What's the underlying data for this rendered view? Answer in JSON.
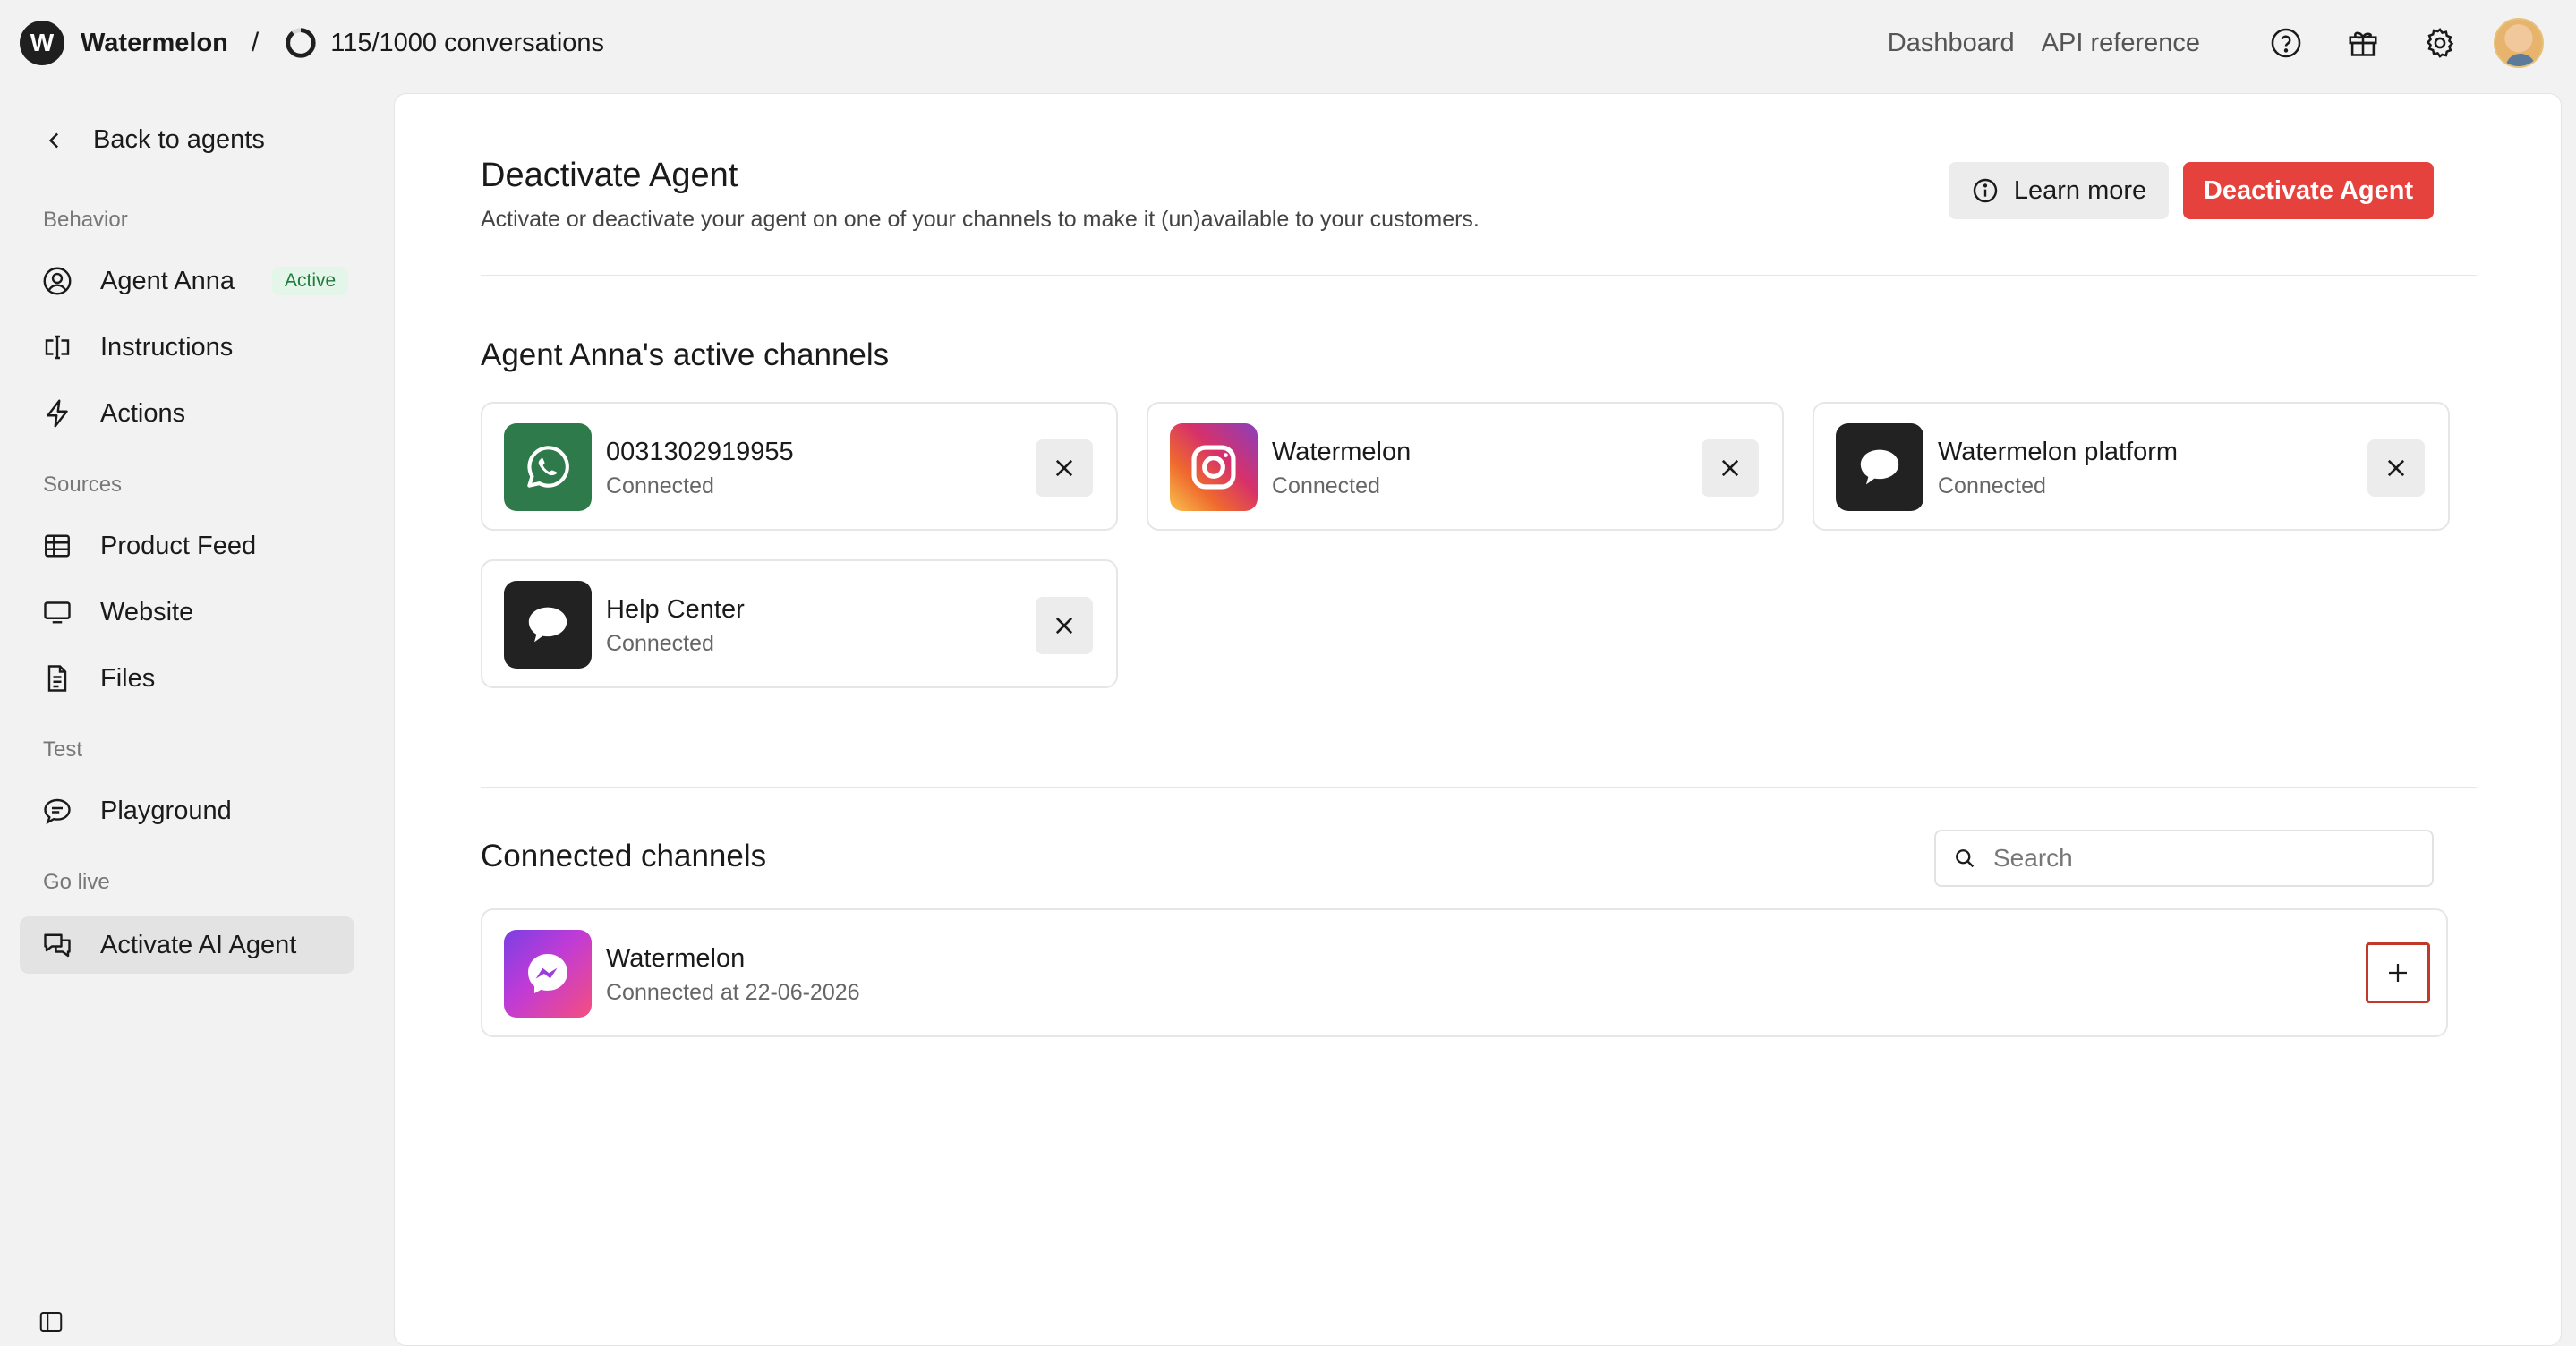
{
  "header": {
    "logo_letter": "W",
    "workspace": "Watermelon",
    "separator": "/",
    "usage": "115/1000 conversations",
    "links": [
      "Dashboard",
      "API reference"
    ],
    "icons": [
      "help-icon",
      "gift-icon",
      "settings-icon",
      "avatar"
    ]
  },
  "sidebar": {
    "back_label": "Back to agents",
    "sections": {
      "behavior": "Behavior",
      "sources": "Sources",
      "test": "Test",
      "go_live": "Go live"
    },
    "items": {
      "agent": {
        "label": "Agent Anna",
        "badge": "Active",
        "icon": "user-circle-icon"
      },
      "instructions": {
        "label": "Instructions",
        "icon": "text-cursor-icon"
      },
      "actions": {
        "label": "Actions",
        "icon": "lightning-icon"
      },
      "product_feed": {
        "label": "Product Feed",
        "icon": "table-icon"
      },
      "website": {
        "label": "Website",
        "icon": "monitor-icon"
      },
      "files": {
        "label": "Files",
        "icon": "document-icon"
      },
      "playground": {
        "label": "Playground",
        "icon": "chat-bubble-icon"
      },
      "activate": {
        "label": "Activate AI Agent",
        "icon": "chats-icon",
        "selected": true
      }
    }
  },
  "main": {
    "title": "Deactivate Agent",
    "subtitle": "Activate or deactivate your agent on one of your channels to make it (un)available to your customers.",
    "learn_more": "Learn more",
    "deactivate": "Deactivate Agent",
    "active_channels_title": "Agent Anna's active channels",
    "active_channels": [
      {
        "name": "0031302919955",
        "status": "Connected",
        "icon": "whatsapp-icon"
      },
      {
        "name": "Watermelon",
        "status": "Connected",
        "icon": "instagram-icon"
      },
      {
        "name": "Watermelon platform",
        "status": "Connected",
        "icon": "speech-bubble-icon"
      },
      {
        "name": "Help Center",
        "status": "Connected",
        "icon": "speech-bubble-icon"
      }
    ],
    "connected_title": "Connected channels",
    "search_placeholder": "Search",
    "connected_channels": [
      {
        "name": "Watermelon",
        "status": "Connected at 22-06-2026",
        "icon": "messenger-icon"
      }
    ]
  },
  "colors": {
    "danger": "#e5413d",
    "badge_bg": "#e4f6e9",
    "badge_text": "#1f7a3c",
    "highlight_border": "#c0392b"
  }
}
